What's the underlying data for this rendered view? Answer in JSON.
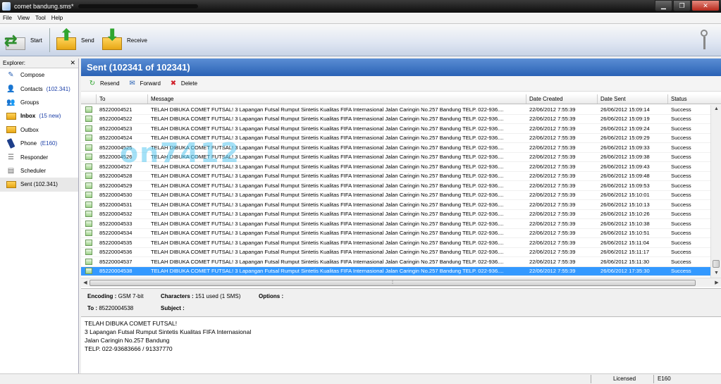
{
  "window": {
    "title": "comet bandung.sms*"
  },
  "menu": [
    "File",
    "View",
    "Tool",
    "Help"
  ],
  "toolbar": {
    "start": "Start",
    "send": "Send",
    "receive": "Receive"
  },
  "explorer": {
    "title": "Explorer:",
    "close": "✕",
    "items": [
      {
        "label": "Compose",
        "count": "",
        "icon": "compose-icon"
      },
      {
        "label": "Contacts",
        "count": "(102.341)",
        "icon": "contacts-icon"
      },
      {
        "label": "Groups",
        "count": "",
        "icon": "groups-icon"
      },
      {
        "label": "Inbox",
        "count": "(15 new)",
        "icon": "inbox-icon"
      },
      {
        "label": "Outbox",
        "count": "",
        "icon": "outbox-icon"
      },
      {
        "label": "Phone",
        "count": "(E160)",
        "icon": "phone-icon"
      },
      {
        "label": "Responder",
        "count": "",
        "icon": "responder-icon"
      },
      {
        "label": "Scheduler",
        "count": "",
        "icon": "scheduler-icon"
      },
      {
        "label": "Sent (102.341)",
        "count": "",
        "icon": "sent-icon"
      }
    ]
  },
  "main": {
    "title": "Sent (102341 of 102341)",
    "actions": {
      "resend": "Resend",
      "forward": "Forward",
      "delete": "Delete"
    },
    "columns": [
      "To",
      "Message",
      "Date Created",
      "Date Sent",
      "Status"
    ],
    "rows": [
      {
        "to": "85220004521",
        "message": "TELAH DIBUKA COMET FUTSAL!  3 Lapangan Futsal Rumput Sintetis Kualitas FIFA Internasional  Jalan Caringin No.257 Bandung TELP.  022-936....",
        "created": "22/06/2012 7:55:39",
        "sent": "26/06/2012 15:09:14",
        "status": "Success"
      },
      {
        "to": "85220004522",
        "message": "TELAH DIBUKA COMET FUTSAL!  3 Lapangan Futsal Rumput Sintetis Kualitas FIFA Internasional  Jalan Caringin No.257 Bandung TELP.  022-936....",
        "created": "22/06/2012 7:55:39",
        "sent": "26/06/2012 15:09:19",
        "status": "Success"
      },
      {
        "to": "85220004523",
        "message": "TELAH DIBUKA COMET FUTSAL!  3 Lapangan Futsal Rumput Sintetis Kualitas FIFA Internasional  Jalan Caringin No.257 Bandung TELP.  022-936....",
        "created": "22/06/2012 7:55:39",
        "sent": "26/06/2012 15:09:24",
        "status": "Success"
      },
      {
        "to": "85220004524",
        "message": "TELAH DIBUKA COMET FUTSAL!  3 Lapangan Futsal Rumput Sintetis Kualitas FIFA Internasional  Jalan Caringin No.257 Bandung TELP.  022-936....",
        "created": "22/06/2012 7:55:39",
        "sent": "26/06/2012 15:09:29",
        "status": "Success"
      },
      {
        "to": "85220004525",
        "message": "TELAH DIBUKA COMET FUTSAL!  3 Lapangan Futsal Rumput Sintetis Kualitas FIFA Internasional  Jalan Caringin No.257 Bandung TELP.  022-936....",
        "created": "22/06/2012 7:55:39",
        "sent": "26/06/2012 15:09:33",
        "status": "Success"
      },
      {
        "to": "85220004526",
        "message": "TELAH DIBUKA COMET FUTSAL!  3 Lapangan Futsal Rumput Sintetis Kualitas FIFA Internasional  Jalan Caringin No.257 Bandung TELP.  022-936....",
        "created": "22/06/2012 7:55:39",
        "sent": "26/06/2012 15:09:38",
        "status": "Success"
      },
      {
        "to": "85220004527",
        "message": "TELAH DIBUKA COMET FUTSAL!  3 Lapangan Futsal Rumput Sintetis Kualitas FIFA Internasional  Jalan Caringin No.257 Bandung TELP.  022-936....",
        "created": "22/06/2012 7:55:39",
        "sent": "26/06/2012 15:09:43",
        "status": "Success"
      },
      {
        "to": "85220004528",
        "message": "TELAH DIBUKA COMET FUTSAL!  3 Lapangan Futsal Rumput Sintetis Kualitas FIFA Internasional  Jalan Caringin No.257 Bandung TELP.  022-936....",
        "created": "22/06/2012 7:55:39",
        "sent": "26/06/2012 15:09:48",
        "status": "Success"
      },
      {
        "to": "85220004529",
        "message": "TELAH DIBUKA COMET FUTSAL!  3 Lapangan Futsal Rumput Sintetis Kualitas FIFA Internasional  Jalan Caringin No.257 Bandung TELP.  022-936....",
        "created": "22/06/2012 7:55:39",
        "sent": "26/06/2012 15:09:53",
        "status": "Success"
      },
      {
        "to": "85220004530",
        "message": "TELAH DIBUKA COMET FUTSAL!  3 Lapangan Futsal Rumput Sintetis Kualitas FIFA Internasional  Jalan Caringin No.257 Bandung TELP.  022-936....",
        "created": "22/06/2012 7:55:39",
        "sent": "26/06/2012 15:10:01",
        "status": "Success"
      },
      {
        "to": "85220004531",
        "message": "TELAH DIBUKA COMET FUTSAL!  3 Lapangan Futsal Rumput Sintetis Kualitas FIFA Internasional  Jalan Caringin No.257 Bandung TELP.  022-936....",
        "created": "22/06/2012 7:55:39",
        "sent": "26/06/2012 15:10:13",
        "status": "Success"
      },
      {
        "to": "85220004532",
        "message": "TELAH DIBUKA COMET FUTSAL!  3 Lapangan Futsal Rumput Sintetis Kualitas FIFA Internasional  Jalan Caringin No.257 Bandung TELP.  022-936....",
        "created": "22/06/2012 7:55:39",
        "sent": "26/06/2012 15:10:26",
        "status": "Success"
      },
      {
        "to": "85220004533",
        "message": "TELAH DIBUKA COMET FUTSAL!  3 Lapangan Futsal Rumput Sintetis Kualitas FIFA Internasional  Jalan Caringin No.257 Bandung TELP.  022-936....",
        "created": "22/06/2012 7:55:39",
        "sent": "26/06/2012 15:10:38",
        "status": "Success"
      },
      {
        "to": "85220004534",
        "message": "TELAH DIBUKA COMET FUTSAL!  3 Lapangan Futsal Rumput Sintetis Kualitas FIFA Internasional  Jalan Caringin No.257 Bandung TELP.  022-936....",
        "created": "22/06/2012 7:55:39",
        "sent": "26/06/2012 15:10:51",
        "status": "Success"
      },
      {
        "to": "85220004535",
        "message": "TELAH DIBUKA COMET FUTSAL!  3 Lapangan Futsal Rumput Sintetis Kualitas FIFA Internasional  Jalan Caringin No.257 Bandung TELP.  022-936....",
        "created": "22/06/2012 7:55:39",
        "sent": "26/06/2012 15:11:04",
        "status": "Success"
      },
      {
        "to": "85220004536",
        "message": "TELAH DIBUKA COMET FUTSAL!  3 Lapangan Futsal Rumput Sintetis Kualitas FIFA Internasional  Jalan Caringin No.257 Bandung TELP.  022-936....",
        "created": "22/06/2012 7:55:39",
        "sent": "26/06/2012 15:11:17",
        "status": "Success"
      },
      {
        "to": "85220004537",
        "message": "TELAH DIBUKA COMET FUTSAL!  3 Lapangan Futsal Rumput Sintetis Kualitas FIFA Internasional  Jalan Caringin No.257 Bandung TELP.  022-936....",
        "created": "22/06/2012 7:55:39",
        "sent": "26/06/2012 15:11:30",
        "status": "Success"
      },
      {
        "to": "85220004538",
        "message": "TELAH DIBUKA COMET FUTSAL!  3 Lapangan Futsal Rumput Sintetis Kualitas FIFA Internasional  Jalan Caringin No.257 Bandung TELP.  022-936....",
        "created": "22/06/2012 7:55:39",
        "sent": "26/06/2012 17:35:30",
        "status": "Success",
        "selected": true
      }
    ]
  },
  "details": {
    "encoding_label": "Encoding :",
    "encoding": "GSM 7-bit",
    "characters_label": "Characters :",
    "characters": "151 used (1 SMS)",
    "options_label": "Options :",
    "to_label": "To :",
    "to": "85220004538",
    "subject_label": "Subject :"
  },
  "body_lines": [
    "TELAH DIBUKA COMET FUTSAL!",
    "3 Lapangan Futsal Rumput Sintetis Kualitas FIFA Internasional",
    "Jalan Caringin No.257 Bandung",
    "TELP.  022-93683666 / 91337770"
  ],
  "status": {
    "license": "Licensed",
    "device": "E160"
  },
  "watermark": "on7412",
  "colors": {
    "title_blue": "#2a62b5",
    "selection": "#3399ff"
  }
}
